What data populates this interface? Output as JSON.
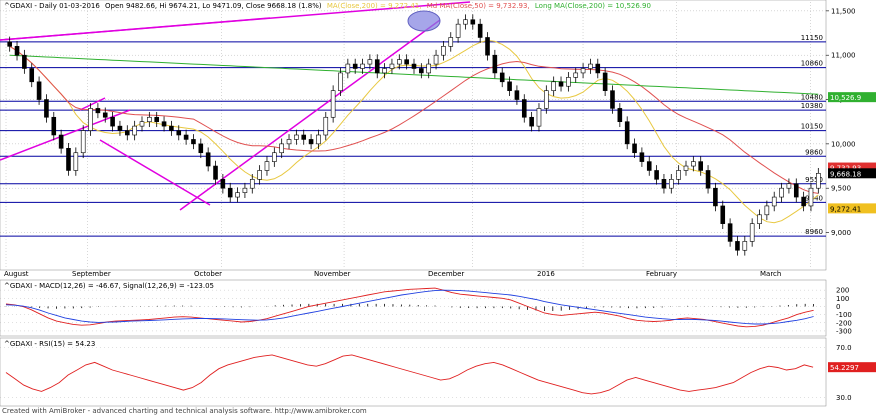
{
  "header": {
    "symbol": "^GDAXI - Daily 01-03-2016",
    "ohlc": "Open 9482.66, Hi 9674.21, Lo 9471.09, Close 9668.18 (1.8%)",
    "ma_label": "MA(Close,200) = 9,272.41,",
    "md_label": "Md MA(Close,50) = 9,732.93,",
    "long_label": "Long MA(Close,200) = 10,526.90"
  },
  "colors": {
    "price": "#000000",
    "ma_short": "#e8c840",
    "ma_mid": "#e05050",
    "ma_long": "#30b030",
    "trend": "#e000e0",
    "hline": "#0000a0",
    "macd": "#e02020",
    "signal": "#2040e0",
    "rsi": "#e02020",
    "grid": "#b0b0b0"
  },
  "chart_data": [
    {
      "type": "candlestick",
      "name": "price",
      "x_labels": [
        "August",
        "September",
        "October",
        "November",
        "December",
        "2016",
        "February",
        "March"
      ],
      "ylim": [
        8600,
        11600
      ],
      "y_ticks": [
        9000,
        9500,
        10000,
        10500,
        11000,
        11500
      ],
      "y_tick_labels": [
        "9,000",
        "9,500",
        "10,000",
        "10,500",
        "11,000",
        "11,500"
      ],
      "levels": [
        {
          "value": 11150,
          "label": "11150"
        },
        {
          "value": 10860,
          "label": "10860"
        },
        {
          "value": 10480,
          "label": "10480"
        },
        {
          "value": 10380,
          "label": "10380"
        },
        {
          "value": 10150,
          "label": "10150"
        },
        {
          "value": 9860,
          "label": "9860"
        },
        {
          "value": 9550,
          "label": "9550"
        },
        {
          "value": 9340,
          "label": "9340"
        },
        {
          "value": 8960,
          "label": "8960"
        }
      ],
      "badges": [
        {
          "value": 10526.9,
          "label": "10,526.9",
          "color": "#30b030"
        },
        {
          "value": 9732.93,
          "label": "9,732.93",
          "color": "#e03030"
        },
        {
          "value": 9668.18,
          "label": "9,668.18",
          "color": "#000000"
        },
        {
          "value": 9272.41,
          "label": "9,272.41",
          "color": "#f0c020"
        }
      ],
      "closes": [
        11100,
        11000,
        10850,
        10700,
        10500,
        10300,
        10100,
        9950,
        9700,
        9900,
        10150,
        10400,
        10350,
        10300,
        10200,
        10150,
        10100,
        10200,
        10250,
        10300,
        10250,
        10200,
        10150,
        10100,
        10050,
        10000,
        9900,
        9750,
        9600,
        9500,
        9400,
        9450,
        9500,
        9600,
        9700,
        9800,
        9900,
        10000,
        10050,
        10100,
        10050,
        10000,
        10100,
        10300,
        10600,
        10800,
        10900,
        10850,
        10900,
        10950,
        10800,
        10850,
        10900,
        10950,
        10900,
        10850,
        10800,
        10900,
        11000,
        11100,
        11200,
        11350,
        11400,
        11350,
        11200,
        11000,
        10800,
        10700,
        10600,
        10500,
        10300,
        10200,
        10400,
        10600,
        10700,
        10650,
        10750,
        10800,
        10850,
        10900,
        10800,
        10600,
        10400,
        10250,
        10000,
        9900,
        9800,
        9700,
        9600,
        9500,
        9600,
        9700,
        9750,
        9800,
        9700,
        9500,
        9300,
        9100,
        8900,
        8800,
        8900,
        9100,
        9200,
        9300,
        9400,
        9500,
        9550,
        9400,
        9300,
        9500,
        9668
      ]
    },
    {
      "type": "line",
      "name": "MACD",
      "title": "^GDAXI - MACD(12,26) = -46.67, Signal(12,26,9) = -123.05",
      "ylim": [
        -350,
        300
      ],
      "y_ticks": [
        200,
        100,
        0,
        -100,
        -200,
        -300
      ],
      "y_tick_labels": [
        "200",
        "100",
        "0",
        "-100",
        "-200",
        "-300"
      ],
      "macd": [
        30,
        20,
        0,
        -40,
        -90,
        -140,
        -180,
        -200,
        -220,
        -230,
        -225,
        -210,
        -190,
        -180,
        -175,
        -170,
        -165,
        -160,
        -150,
        -140,
        -130,
        -125,
        -130,
        -140,
        -150,
        -160,
        -170,
        -180,
        -190,
        -185,
        -170,
        -150,
        -120,
        -90,
        -60,
        -30,
        0,
        20,
        40,
        60,
        80,
        100,
        120,
        140,
        160,
        180,
        190,
        200,
        210,
        215,
        220,
        225,
        200,
        170,
        150,
        140,
        130,
        120,
        110,
        100,
        80,
        40,
        0,
        -40,
        -80,
        -100,
        -110,
        -100,
        -90,
        -80,
        -70,
        -80,
        -100,
        -120,
        -150,
        -170,
        -180,
        -185,
        -180,
        -170,
        -150,
        -140,
        -150,
        -160,
        -180,
        -200,
        -220,
        -240,
        -250,
        -245,
        -230,
        -200,
        -170,
        -140,
        -100,
        -70,
        -46.67
      ],
      "signal": [
        20,
        15,
        5,
        -15,
        -45,
        -80,
        -110,
        -140,
        -160,
        -180,
        -190,
        -195,
        -193,
        -190,
        -185,
        -180,
        -176,
        -172,
        -168,
        -163,
        -158,
        -152,
        -150,
        -148,
        -148,
        -150,
        -153,
        -157,
        -162,
        -166,
        -168,
        -165,
        -155,
        -140,
        -120,
        -100,
        -80,
        -60,
        -40,
        -20,
        0,
        20,
        40,
        60,
        80,
        100,
        120,
        140,
        155,
        170,
        185,
        195,
        200,
        198,
        194,
        188,
        180,
        170,
        160,
        150,
        140,
        125,
        105,
        85,
        60,
        40,
        20,
        5,
        -10,
        -25,
        -40,
        -55,
        -70,
        -85,
        -100,
        -115,
        -130,
        -140,
        -150,
        -158,
        -160,
        -158,
        -160,
        -165,
        -170,
        -180,
        -190,
        -200,
        -210,
        -215,
        -215,
        -210,
        -200,
        -185,
        -170,
        -150,
        -123.05
      ]
    },
    {
      "type": "line",
      "name": "RSI",
      "title": "^GDAXI - RSI(15) = 54.23",
      "ylim": [
        25,
        75
      ],
      "y_ticks": [
        70,
        30
      ],
      "y_tick_labels": [
        "70.0",
        "30.0"
      ],
      "badge": "54.2297",
      "values": [
        50,
        45,
        40,
        37,
        35,
        38,
        42,
        48,
        52,
        56,
        58,
        55,
        52,
        50,
        48,
        46,
        44,
        42,
        40,
        38,
        36,
        38,
        42,
        48,
        53,
        56,
        58,
        60,
        62,
        63,
        64,
        62,
        60,
        58,
        56,
        55,
        57,
        60,
        63,
        64,
        62,
        60,
        58,
        56,
        54,
        52,
        50,
        48,
        46,
        44,
        45,
        48,
        52,
        55,
        57,
        58,
        56,
        53,
        50,
        47,
        44,
        42,
        40,
        38,
        36,
        34,
        33,
        34,
        36,
        40,
        44,
        46,
        44,
        42,
        40,
        38,
        36,
        35,
        36,
        37,
        38,
        40,
        42,
        46,
        50,
        53,
        55,
        54,
        52,
        53,
        56,
        54.23
      ]
    }
  ],
  "footer": "Created with AmiBroker - advanced charting and technical analysis software. http://www.amibroker.com"
}
